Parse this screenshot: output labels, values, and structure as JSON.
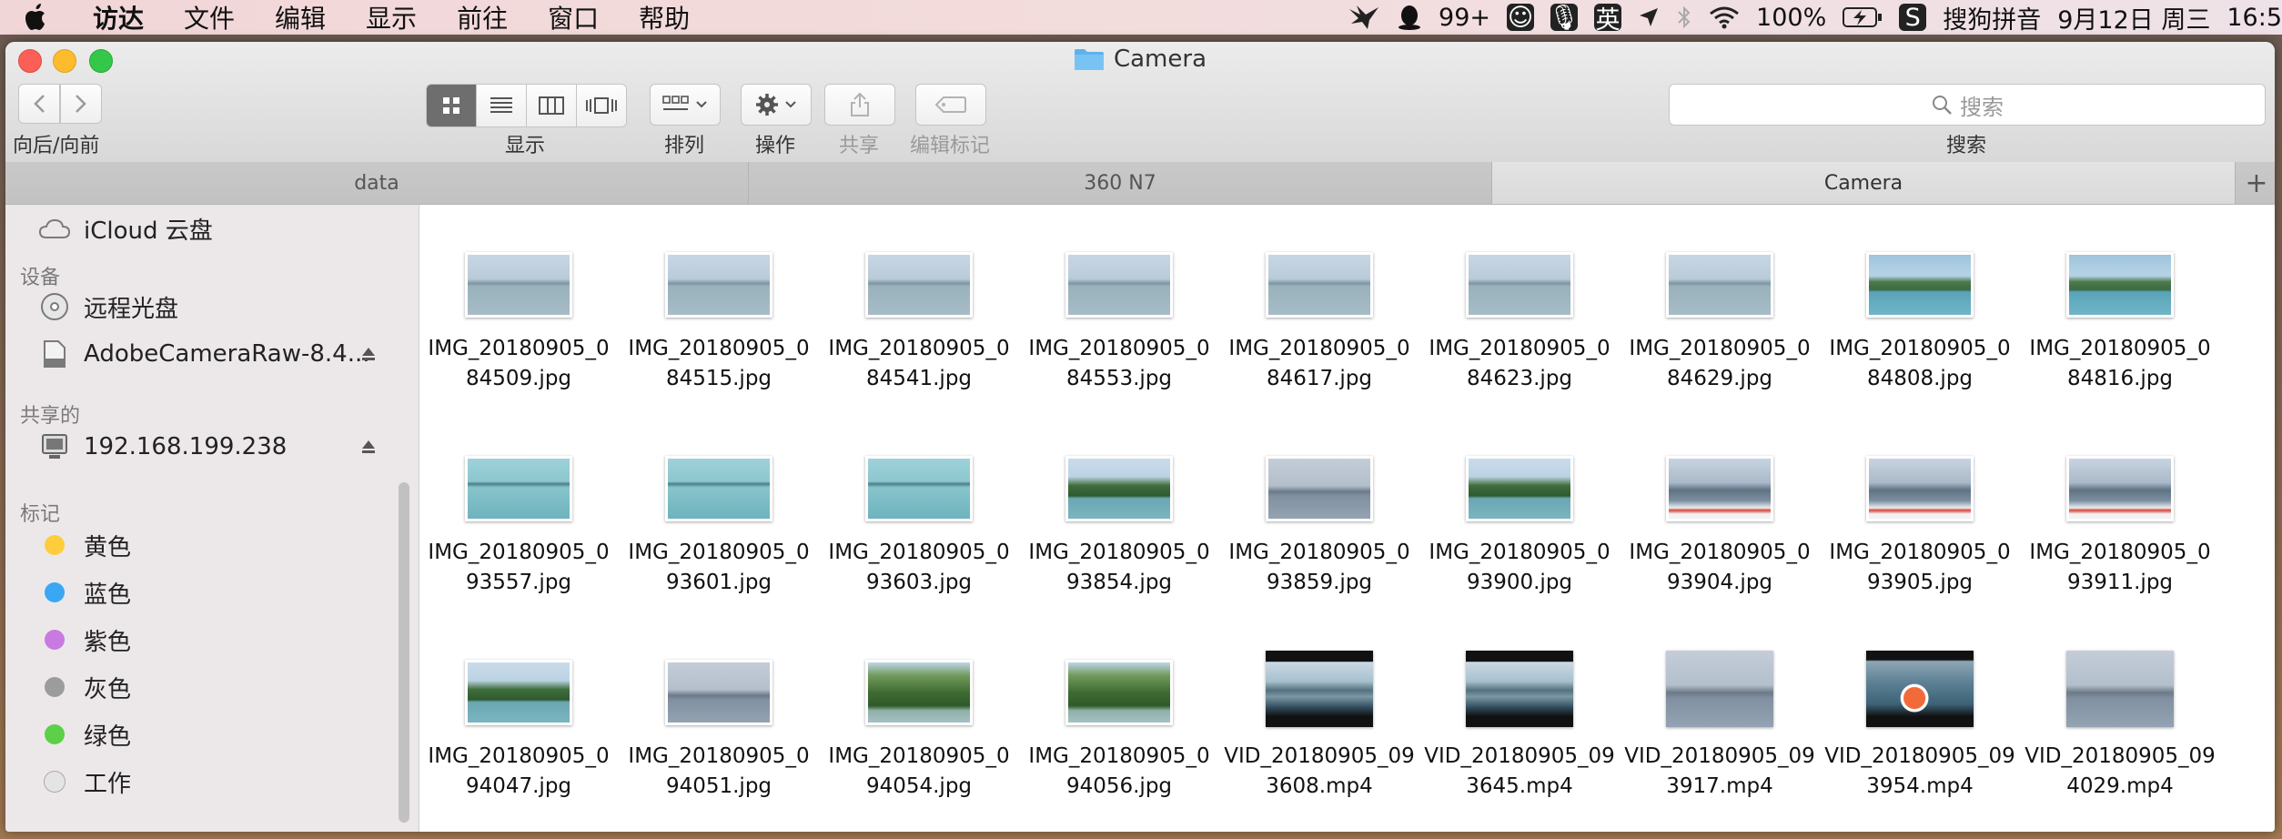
{
  "menubar": {
    "items": [
      "访达",
      "文件",
      "编辑",
      "显示",
      "前往",
      "窗口",
      "帮助"
    ],
    "status": {
      "qq_count": "99+",
      "ime_label": "英",
      "battery": "100%",
      "input_method": "搜狗拼音",
      "date": "9月12日 周三",
      "time": "16:5"
    }
  },
  "window": {
    "title": "Camera",
    "toolbar": {
      "nav_label": "向后/向前",
      "view_label": "显示",
      "arrange_label": "排列",
      "action_label": "操作",
      "share_label": "共享",
      "tags_label": "编辑标记",
      "search_placeholder": "搜索",
      "search_label": "搜索"
    },
    "tabs": [
      "data",
      "360 N7",
      "Camera"
    ],
    "active_tab": 2
  },
  "sidebar": {
    "icloud": "iCloud 云盘",
    "devices_header": "设备",
    "devices": [
      "远程光盘",
      "AdobeCameraRaw-8.4..."
    ],
    "shared_header": "共享的",
    "shared": [
      "192.168.199.238"
    ],
    "tags_header": "标记",
    "tags": [
      {
        "name": "黄色",
        "color": "#fdcd3c"
      },
      {
        "name": "蓝色",
        "color": "#3aa7f5"
      },
      {
        "name": "紫色",
        "color": "#c97ae0"
      },
      {
        "name": "灰色",
        "color": "#9c9c9c"
      },
      {
        "name": "绿色",
        "color": "#5bd048"
      },
      {
        "name": "工作",
        "color": "#e4e4e4"
      }
    ]
  },
  "files": [
    {
      "name": "IMG_20180905_084509.jpg",
      "kind": "photo",
      "scene": "bridge"
    },
    {
      "name": "IMG_20180905_084515.jpg",
      "kind": "photo",
      "scene": "bridge"
    },
    {
      "name": "IMG_20180905_084541.jpg",
      "kind": "photo",
      "scene": "bridge"
    },
    {
      "name": "IMG_20180905_084553.jpg",
      "kind": "photo",
      "scene": "bridge"
    },
    {
      "name": "IMG_20180905_084617.jpg",
      "kind": "photo",
      "scene": "bridge"
    },
    {
      "name": "IMG_20180905_084623.jpg",
      "kind": "photo",
      "scene": "bridge"
    },
    {
      "name": "IMG_20180905_084629.jpg",
      "kind": "photo",
      "scene": "bridge"
    },
    {
      "name": "IMG_20180905_084808.jpg",
      "kind": "photo",
      "scene": "island"
    },
    {
      "name": "IMG_20180905_084816.jpg",
      "kind": "photo",
      "scene": "island"
    },
    {
      "name": "IMG_20180905_093557.jpg",
      "kind": "photo",
      "scene": "cyanbridge"
    },
    {
      "name": "IMG_20180905_093601.jpg",
      "kind": "photo",
      "scene": "cyanbridge"
    },
    {
      "name": "IMG_20180905_093603.jpg",
      "kind": "photo",
      "scene": "cyanbridge"
    },
    {
      "name": "IMG_20180905_093854.jpg",
      "kind": "photo",
      "scene": "hill"
    },
    {
      "name": "IMG_20180905_093859.jpg",
      "kind": "photo",
      "scene": "greylake"
    },
    {
      "name": "IMG_20180905_093900.jpg",
      "kind": "photo",
      "scene": "hill"
    },
    {
      "name": "IMG_20180905_093904.jpg",
      "kind": "photo",
      "scene": "boat"
    },
    {
      "name": "IMG_20180905_093905.jpg",
      "kind": "photo",
      "scene": "boat"
    },
    {
      "name": "IMG_20180905_093911.jpg",
      "kind": "photo",
      "scene": "boat"
    },
    {
      "name": "IMG_20180905_094047.jpg",
      "kind": "photo",
      "scene": "hill"
    },
    {
      "name": "IMG_20180905_094051.jpg",
      "kind": "photo",
      "scene": "greylake"
    },
    {
      "name": "IMG_20180905_094054.jpg",
      "kind": "photo",
      "scene": "forest"
    },
    {
      "name": "IMG_20180905_094056.jpg",
      "kind": "photo",
      "scene": "forest"
    },
    {
      "name": "VID_20180905_093608.mp4",
      "kind": "video",
      "scene": "wavebridge"
    },
    {
      "name": "VID_20180905_093645.mp4",
      "kind": "video",
      "scene": "wavebridge"
    },
    {
      "name": "VID_20180905_093917.mp4",
      "kind": "video",
      "scene": "greylake"
    },
    {
      "name": "VID_20180905_093954.mp4",
      "kind": "video",
      "scene": "buoy"
    },
    {
      "name": "VID_20180905_094029.mp4",
      "kind": "video",
      "scene": "greylake"
    }
  ]
}
